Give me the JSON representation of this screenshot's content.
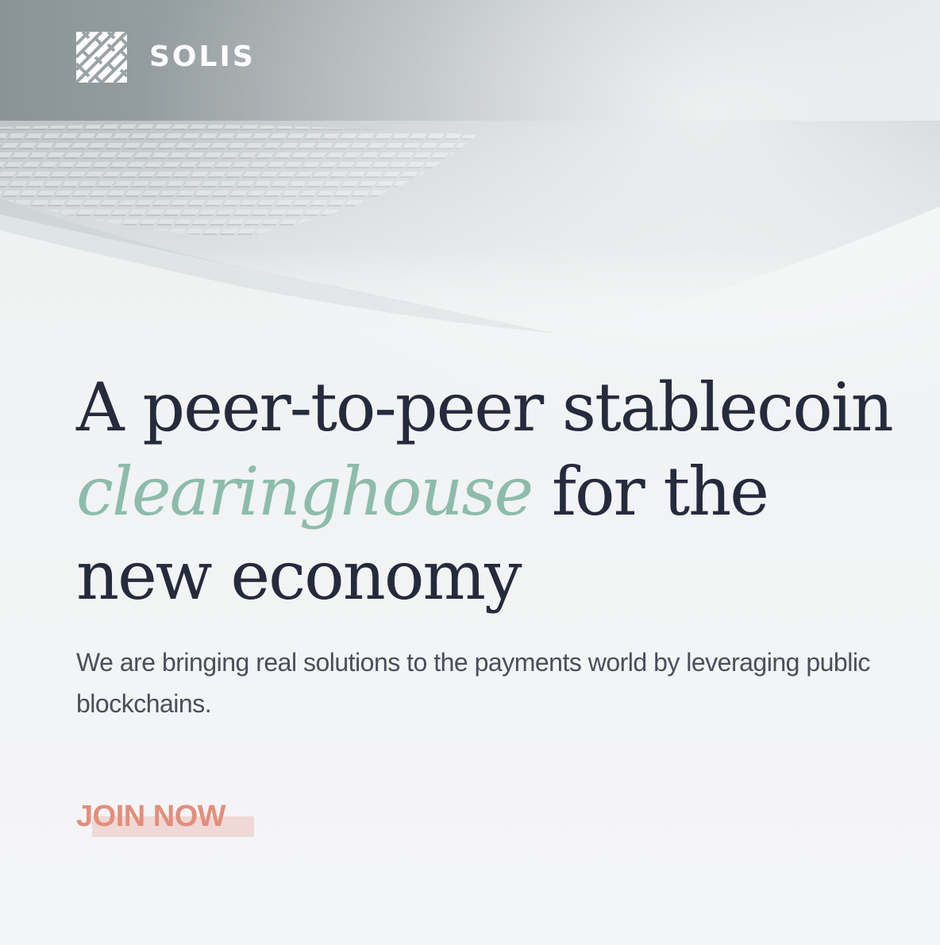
{
  "brand": {
    "name": "SOLIS",
    "logo_icon": "lattice-logo-icon"
  },
  "hero": {
    "headline_part1": "A peer-to-peer stablecoin ",
    "headline_accent": "clearinghouse",
    "headline_part2": " for the new economy",
    "subtitle": "We are bringing real solutions to the payments world by leveraging public blockchains.",
    "cta_label": "JOIN NOW",
    "background": "architectural-ceiling-image"
  },
  "colors": {
    "headline": "#252a3d",
    "accent": "#8dbcaa",
    "cta": "#e38e7b",
    "header_bar": "#8a9395"
  }
}
